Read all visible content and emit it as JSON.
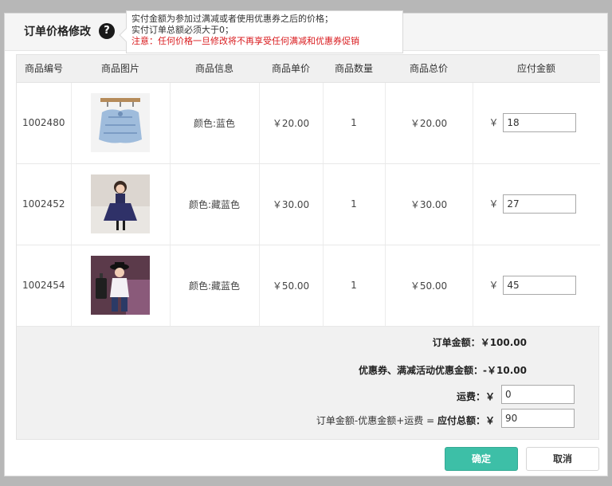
{
  "dialog": {
    "title": "订单价格修改",
    "help_icon": "?",
    "tooltip": {
      "line1": "实付金额为参加过满减或者使用优惠券之后的价格；",
      "line2": "实付订单总额必须大于0；",
      "line3": "注意：任何价格一旦修改将不再享受任何满减和优惠券促销"
    }
  },
  "table": {
    "headers": [
      "商品编号",
      "商品图片",
      "商品信息",
      "商品单价",
      "商品数量",
      "商品总价",
      "应付金额"
    ],
    "currency": "￥",
    "rows": [
      {
        "id": "1002480",
        "info": "颜色:蓝色",
        "unit_price": "￥20.00",
        "qty": "1",
        "total": "￥20.00",
        "pay": "18",
        "image": "blue-knit-cardigan-photo"
      },
      {
        "id": "1002452",
        "info": "颜色:藏蓝色",
        "unit_price": "￥30.00",
        "qty": "1",
        "total": "￥30.00",
        "pay": "27",
        "image": "girl-navy-dress-photo"
      },
      {
        "id": "1002454",
        "info": "颜色:藏蓝色",
        "unit_price": "￥50.00",
        "qty": "1",
        "total": "￥50.00",
        "pay": "45",
        "image": "girl-hat-suitcase-photo"
      }
    ]
  },
  "summary": {
    "order_amount_label": "订单金额：",
    "order_amount_value": "￥100.00",
    "discount_label": "优惠券、满减活动优惠金额：",
    "discount_value": "-￥10.00",
    "shipping_label": "运费：￥",
    "shipping_value": "0",
    "formula_label": "订单金额-优惠金额+运费 = ",
    "total_label": "应付总额：￥",
    "total_value": "90"
  },
  "buttons": {
    "ok": "确定",
    "cancel": "取消"
  },
  "colors": {
    "accent": "#3dbfa7",
    "warning": "#d9191c"
  }
}
